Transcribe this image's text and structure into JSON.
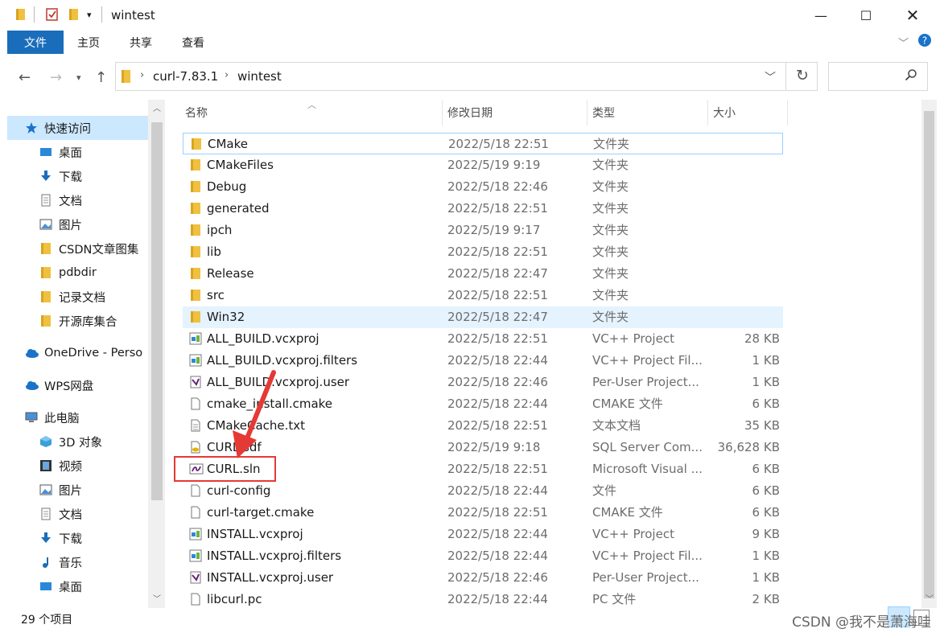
{
  "window": {
    "title": "wintest"
  },
  "ribbon": {
    "tabs": [
      "文件",
      "主页",
      "共享",
      "查看"
    ]
  },
  "address": {
    "path": [
      "curl-7.83.1",
      "wintest"
    ]
  },
  "nav_pane": {
    "items": [
      {
        "label": "快速访问",
        "icon": "star-icon",
        "pinned": false
      },
      {
        "label": "桌面",
        "icon": "desktop-icon",
        "pinned": true
      },
      {
        "label": "下载",
        "icon": "download-icon",
        "pinned": true
      },
      {
        "label": "文档",
        "icon": "document-icon",
        "pinned": true
      },
      {
        "label": "图片",
        "icon": "picture-icon",
        "pinned": true
      },
      {
        "label": "CSDN文章图集",
        "icon": "folder-icon",
        "pinned": false
      },
      {
        "label": "pdbdir",
        "icon": "folder-icon",
        "pinned": false
      },
      {
        "label": "记录文档",
        "icon": "folder-icon",
        "pinned": false
      },
      {
        "label": "开源库集合",
        "icon": "folder-icon",
        "pinned": false
      },
      {
        "label": "OneDrive - Perso",
        "icon": "cloud-icon",
        "pinned": false
      },
      {
        "label": "WPS网盘",
        "icon": "cloud-icon",
        "pinned": false
      },
      {
        "label": "此电脑",
        "icon": "computer-icon",
        "pinned": false
      },
      {
        "label": "3D 对象",
        "icon": "cube-icon",
        "pinned": false
      },
      {
        "label": "视频",
        "icon": "video-icon",
        "pinned": false
      },
      {
        "label": "图片",
        "icon": "picture-icon",
        "pinned": false
      },
      {
        "label": "文档",
        "icon": "document-icon",
        "pinned": false
      },
      {
        "label": "下载",
        "icon": "download-icon",
        "pinned": false
      },
      {
        "label": "音乐",
        "icon": "music-icon",
        "pinned": false
      },
      {
        "label": "桌面",
        "icon": "desktop-icon",
        "pinned": false
      }
    ]
  },
  "columns": [
    "名称",
    "修改日期",
    "类型",
    "大小"
  ],
  "files": [
    {
      "name": "CMake",
      "date": "2022/5/18 22:51",
      "type": "文件夹",
      "size": "",
      "icon": "folder-icon"
    },
    {
      "name": "CMakeFiles",
      "date": "2022/5/19 9:19",
      "type": "文件夹",
      "size": "",
      "icon": "folder-icon"
    },
    {
      "name": "Debug",
      "date": "2022/5/18 22:46",
      "type": "文件夹",
      "size": "",
      "icon": "folder-icon"
    },
    {
      "name": "generated",
      "date": "2022/5/18 22:51",
      "type": "文件夹",
      "size": "",
      "icon": "folder-icon"
    },
    {
      "name": "ipch",
      "date": "2022/5/19 9:17",
      "type": "文件夹",
      "size": "",
      "icon": "folder-icon"
    },
    {
      "name": "lib",
      "date": "2022/5/18 22:51",
      "type": "文件夹",
      "size": "",
      "icon": "folder-icon"
    },
    {
      "name": "Release",
      "date": "2022/5/18 22:47",
      "type": "文件夹",
      "size": "",
      "icon": "folder-icon"
    },
    {
      "name": "src",
      "date": "2022/5/18 22:51",
      "type": "文件夹",
      "size": "",
      "icon": "folder-icon"
    },
    {
      "name": "Win32",
      "date": "2022/5/18 22:47",
      "type": "文件夹",
      "size": "",
      "icon": "folder-icon"
    },
    {
      "name": "ALL_BUILD.vcxproj",
      "date": "2022/5/18 22:51",
      "type": "VC++ Project",
      "size": "28 KB",
      "icon": "vcxproj-icon"
    },
    {
      "name": "ALL_BUILD.vcxproj.filters",
      "date": "2022/5/18 22:44",
      "type": "VC++ Project Fil...",
      "size": "1 KB",
      "icon": "vcxproj-icon"
    },
    {
      "name": "ALL_BUILD.vcxproj.user",
      "date": "2022/5/18 22:46",
      "type": "Per-User Project...",
      "size": "1 KB",
      "icon": "vs-user-icon"
    },
    {
      "name": "cmake_install.cmake",
      "date": "2022/5/18 22:44",
      "type": "CMAKE 文件",
      "size": "6 KB",
      "icon": "file-icon"
    },
    {
      "name": "CMakeCache.txt",
      "date": "2022/5/18 22:51",
      "type": "文本文档",
      "size": "35 KB",
      "icon": "text-file-icon"
    },
    {
      "name": "CURL.sdf",
      "date": "2022/5/19 9:18",
      "type": "SQL Server Com...",
      "size": "36,628 KB",
      "icon": "database-icon"
    },
    {
      "name": "CURL.sln",
      "date": "2022/5/18 22:51",
      "type": "Microsoft Visual ...",
      "size": "6 KB",
      "icon": "vs-solution-icon"
    },
    {
      "name": "curl-config",
      "date": "2022/5/18 22:44",
      "type": "文件",
      "size": "6 KB",
      "icon": "file-icon"
    },
    {
      "name": "curl-target.cmake",
      "date": "2022/5/18 22:51",
      "type": "CMAKE 文件",
      "size": "6 KB",
      "icon": "file-icon"
    },
    {
      "name": "INSTALL.vcxproj",
      "date": "2022/5/18 22:44",
      "type": "VC++ Project",
      "size": "9 KB",
      "icon": "vcxproj-icon"
    },
    {
      "name": "INSTALL.vcxproj.filters",
      "date": "2022/5/18 22:44",
      "type": "VC++ Project Fil...",
      "size": "1 KB",
      "icon": "vcxproj-icon"
    },
    {
      "name": "INSTALL.vcxproj.user",
      "date": "2022/5/18 22:46",
      "type": "Per-User Project...",
      "size": "1 KB",
      "icon": "vs-user-icon"
    },
    {
      "name": "libcurl.pc",
      "date": "2022/5/18 22:44",
      "type": "PC 文件",
      "size": "2 KB",
      "icon": "file-icon"
    }
  ],
  "status": {
    "count": "29 个项目"
  },
  "watermark": "CSDN @我不是萧海哇",
  "colors": {
    "accent": "#1a6dbb",
    "selection": "#cce8ff",
    "annotation": "#e53935"
  }
}
